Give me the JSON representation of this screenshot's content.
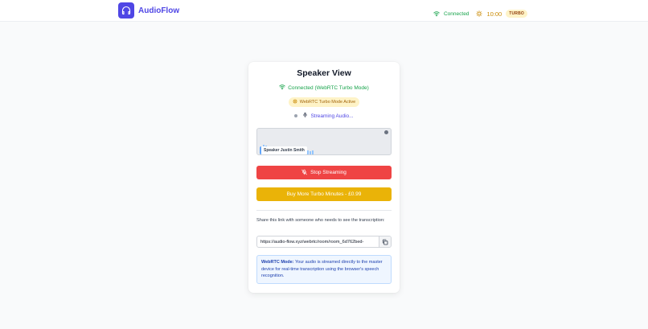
{
  "app": {
    "name": "AudioFlow"
  },
  "header": {
    "connection": "Connected",
    "timer": "10:00",
    "turbo_badge": "TURBO"
  },
  "card": {
    "title": "Speaker View",
    "connection_status": "Connected (WebRTC Turbo Mode)",
    "mode_badge": "WebRTC Turbo Mode Active",
    "streaming_status": "Streaming Audio...",
    "speaker_label": "Speaker Justin Smith",
    "stop_button": "Stop Streaming",
    "buy_button": "Buy More Turbo Minutes - £0.99",
    "share_text": "Share this link with someone who needs to see the transcription:",
    "share_link": "https://audio-flow.xyz/webrtc/room/room_6d762bed-",
    "info_title": "WebRTC Mode:",
    "info_text": "Your audio is streamed directly to the master device for real-time transcription using the browser's speech recognition."
  },
  "colors": {
    "brand": "#4f46e5",
    "connected": "#16a34a",
    "turbo": "#ca8a04",
    "stop": "#ef4444",
    "buy": "#eab308",
    "info_bg": "#eff6ff"
  },
  "icons": {
    "logo": "headphones-icon",
    "connection": "wifi-icon",
    "turbo": "zap-icon",
    "mic": "microphone-icon",
    "mic_off": "microphone-off-icon",
    "copy": "copy-icon"
  }
}
